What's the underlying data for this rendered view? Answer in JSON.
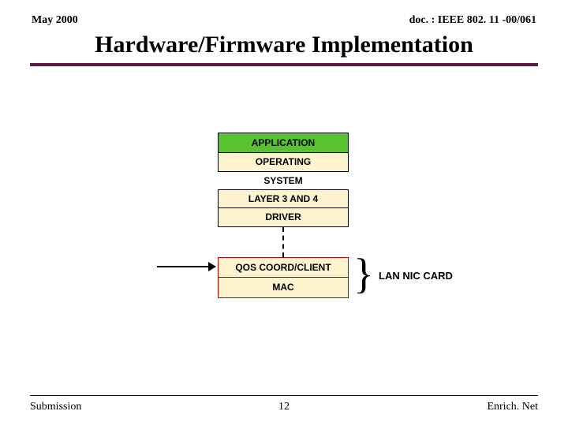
{
  "header": {
    "date": "May 2000",
    "doc_ref": "doc. : IEEE 802. 11 -00/061"
  },
  "title": "Hardware/Firmware Implementation",
  "diagram": {
    "application": "APPLICATION",
    "operating": "OPERATING",
    "system": "SYSTEM",
    "layer34": "LAYER 3 AND 4",
    "driver": "DRIVER",
    "qos": "QOS COORD/CLIENT",
    "mac": "MAC",
    "brace": "}",
    "lan_card": "LAN NIC CARD"
  },
  "footer": {
    "left": "Submission",
    "page": "12",
    "right": "Enrich. Net"
  }
}
